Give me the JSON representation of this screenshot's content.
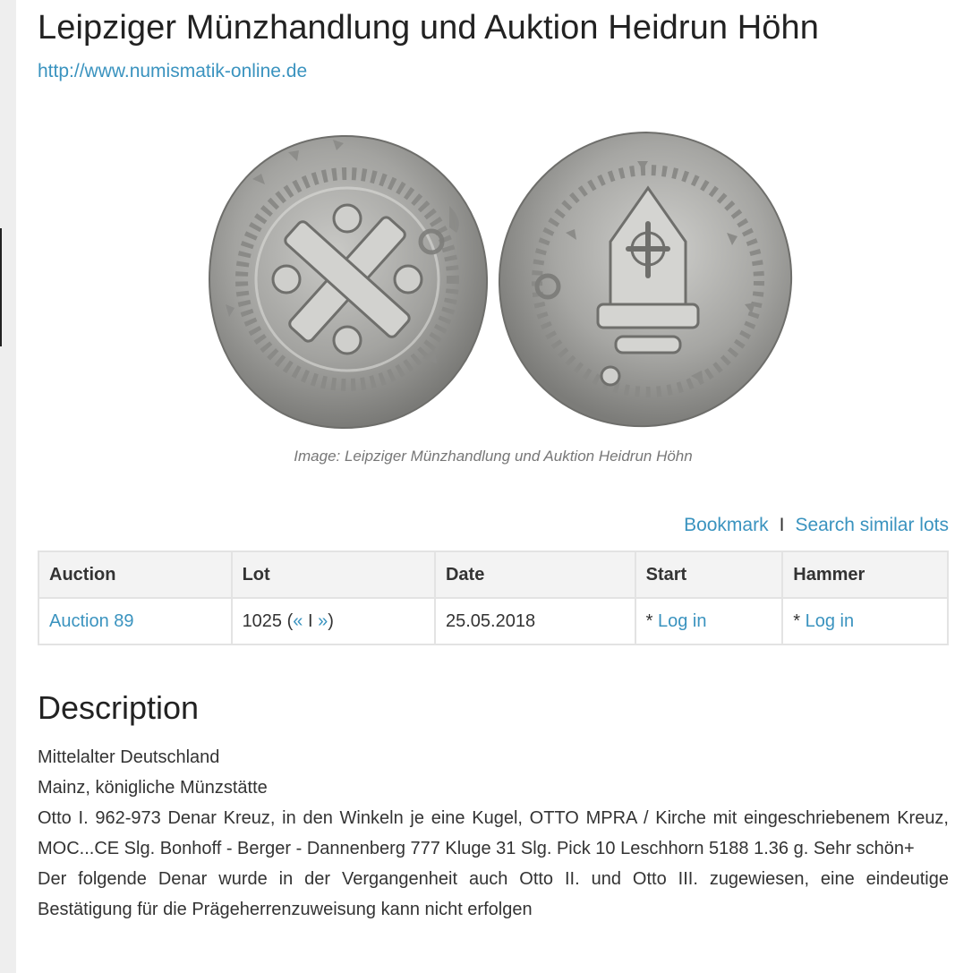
{
  "header": {
    "title": "Leipziger Münzhandlung und Auktion Heidrun Höhn",
    "website": "http://www.numismatik-online.de"
  },
  "image": {
    "caption": "Image: Leipziger Münzhandlung und Auktion Heidrun Höhn",
    "obverse": "coin-obverse-cross",
    "reverse": "coin-reverse-church",
    "metal_color": "#a9a9a6"
  },
  "actions": {
    "bookmark": "Bookmark",
    "separator": "I",
    "search_similar": "Search similar lots"
  },
  "table": {
    "headers": {
      "auction": "Auction",
      "lot": "Lot",
      "date": "Date",
      "start": "Start",
      "hammer": "Hammer"
    },
    "row": {
      "auction": "Auction 89",
      "lot_number": "1025",
      "lot_open_paren": "(",
      "prev": "«",
      "lot_sep": "I",
      "next": "»",
      "lot_close_paren": ")",
      "date": "25.05.2018",
      "start_prefix": "* ",
      "start_login": "Log in",
      "hammer_prefix": "* ",
      "hammer_login": "Log in"
    }
  },
  "description": {
    "title": "Description",
    "lines": [
      "Mittelalter Deutschland",
      "Mainz, königliche Münzstätte",
      "Otto I. 962-973 Denar Kreuz, in den Winkeln je eine Kugel, OTTO MPRA / Kirche mit eingeschriebenem Kreuz, MOC...CE Slg. Bonhoff - Berger - Dannenberg 777 Kluge 31 Slg. Pick 10 Leschhorn 5188 1.36 g. Sehr schön+",
      "Der folgende Denar wurde in der Vergangenheit auch Otto II. und Otto III. zugewiesen, eine eindeutige Bestätigung für die Prägeherrenzuweisung kann nicht erfolgen"
    ]
  },
  "colors": {
    "link": "#3a93bf",
    "table_header_bg": "#f3f3f3",
    "border": "#e3e3e3",
    "page_bg": "#eeeeee"
  }
}
